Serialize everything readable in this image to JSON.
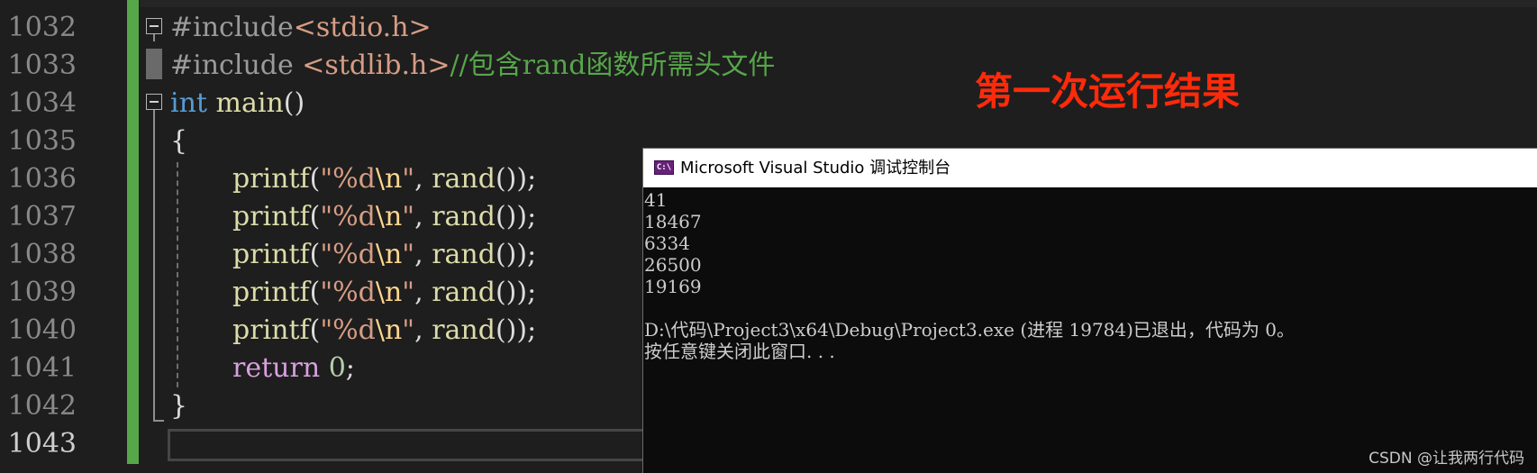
{
  "editor": {
    "line_numbers": [
      "1032",
      "1033",
      "1034",
      "1035",
      "1036",
      "1037",
      "1038",
      "1039",
      "1040",
      "1041",
      "1042",
      "1043"
    ],
    "lines": {
      "l1032": {
        "directive": "#include",
        "header": "<stdio.h>"
      },
      "l1033": {
        "directive": "#include",
        "space": " ",
        "header": "<stdlib.h>",
        "comment": "//包含rand函数所需头文件"
      },
      "l1034": {
        "type": "int",
        "space": " ",
        "name": "main",
        "parens": "()"
      },
      "l1035": {
        "brace": "{"
      },
      "printf_lines": [
        {
          "fn": "printf",
          "open": "(",
          "fmt_open": "\"%d",
          "escape": "\\n",
          "fmt_close": "\"",
          "sep": ", ",
          "call": "rand",
          "close": "());"
        },
        {
          "fn": "printf",
          "open": "(",
          "fmt_open": "\"%d",
          "escape": "\\n",
          "fmt_close": "\"",
          "sep": ", ",
          "call": "rand",
          "close": "());"
        },
        {
          "fn": "printf",
          "open": "(",
          "fmt_open": "\"%d",
          "escape": "\\n",
          "fmt_close": "\"",
          "sep": ", ",
          "call": "rand",
          "close": "());"
        },
        {
          "fn": "printf",
          "open": "(",
          "fmt_open": "\"%d",
          "escape": "\\n",
          "fmt_close": "\"",
          "sep": ", ",
          "call": "rand",
          "close": "());"
        },
        {
          "fn": "printf",
          "open": "(",
          "fmt_open": "\"%d",
          "escape": "\\n",
          "fmt_close": "\"",
          "sep": ", ",
          "call": "rand",
          "close": "());"
        }
      ],
      "l1041": {
        "keyword": "return",
        "space": " ",
        "value": "0",
        "end": ";"
      },
      "l1042": {
        "brace": "}"
      }
    }
  },
  "annotation": {
    "text": "第一次运行结果",
    "color": "#ff2a0a"
  },
  "console": {
    "icon_text": "C:\\",
    "title": "Microsoft Visual Studio 调试控制台",
    "output": [
      "41",
      "18467",
      "6334",
      "26500",
      "19169",
      "",
      "D:\\代码\\Project3\\x64\\Debug\\Project3.exe (进程 19784)已退出，代码为 0。",
      "按任意键关闭此窗口. . ."
    ]
  },
  "watermark": {
    "text": "CSDN @让我两行代码"
  },
  "colors": {
    "editor_bg": "#1e1e1e",
    "change_bar": "#57a64a",
    "comment": "#57a64a",
    "keyword": "#569cd6",
    "function": "#dcdcaa",
    "string": "#d69d85",
    "control_keyword": "#d8a0df",
    "console_bg": "#0c0c0c"
  }
}
